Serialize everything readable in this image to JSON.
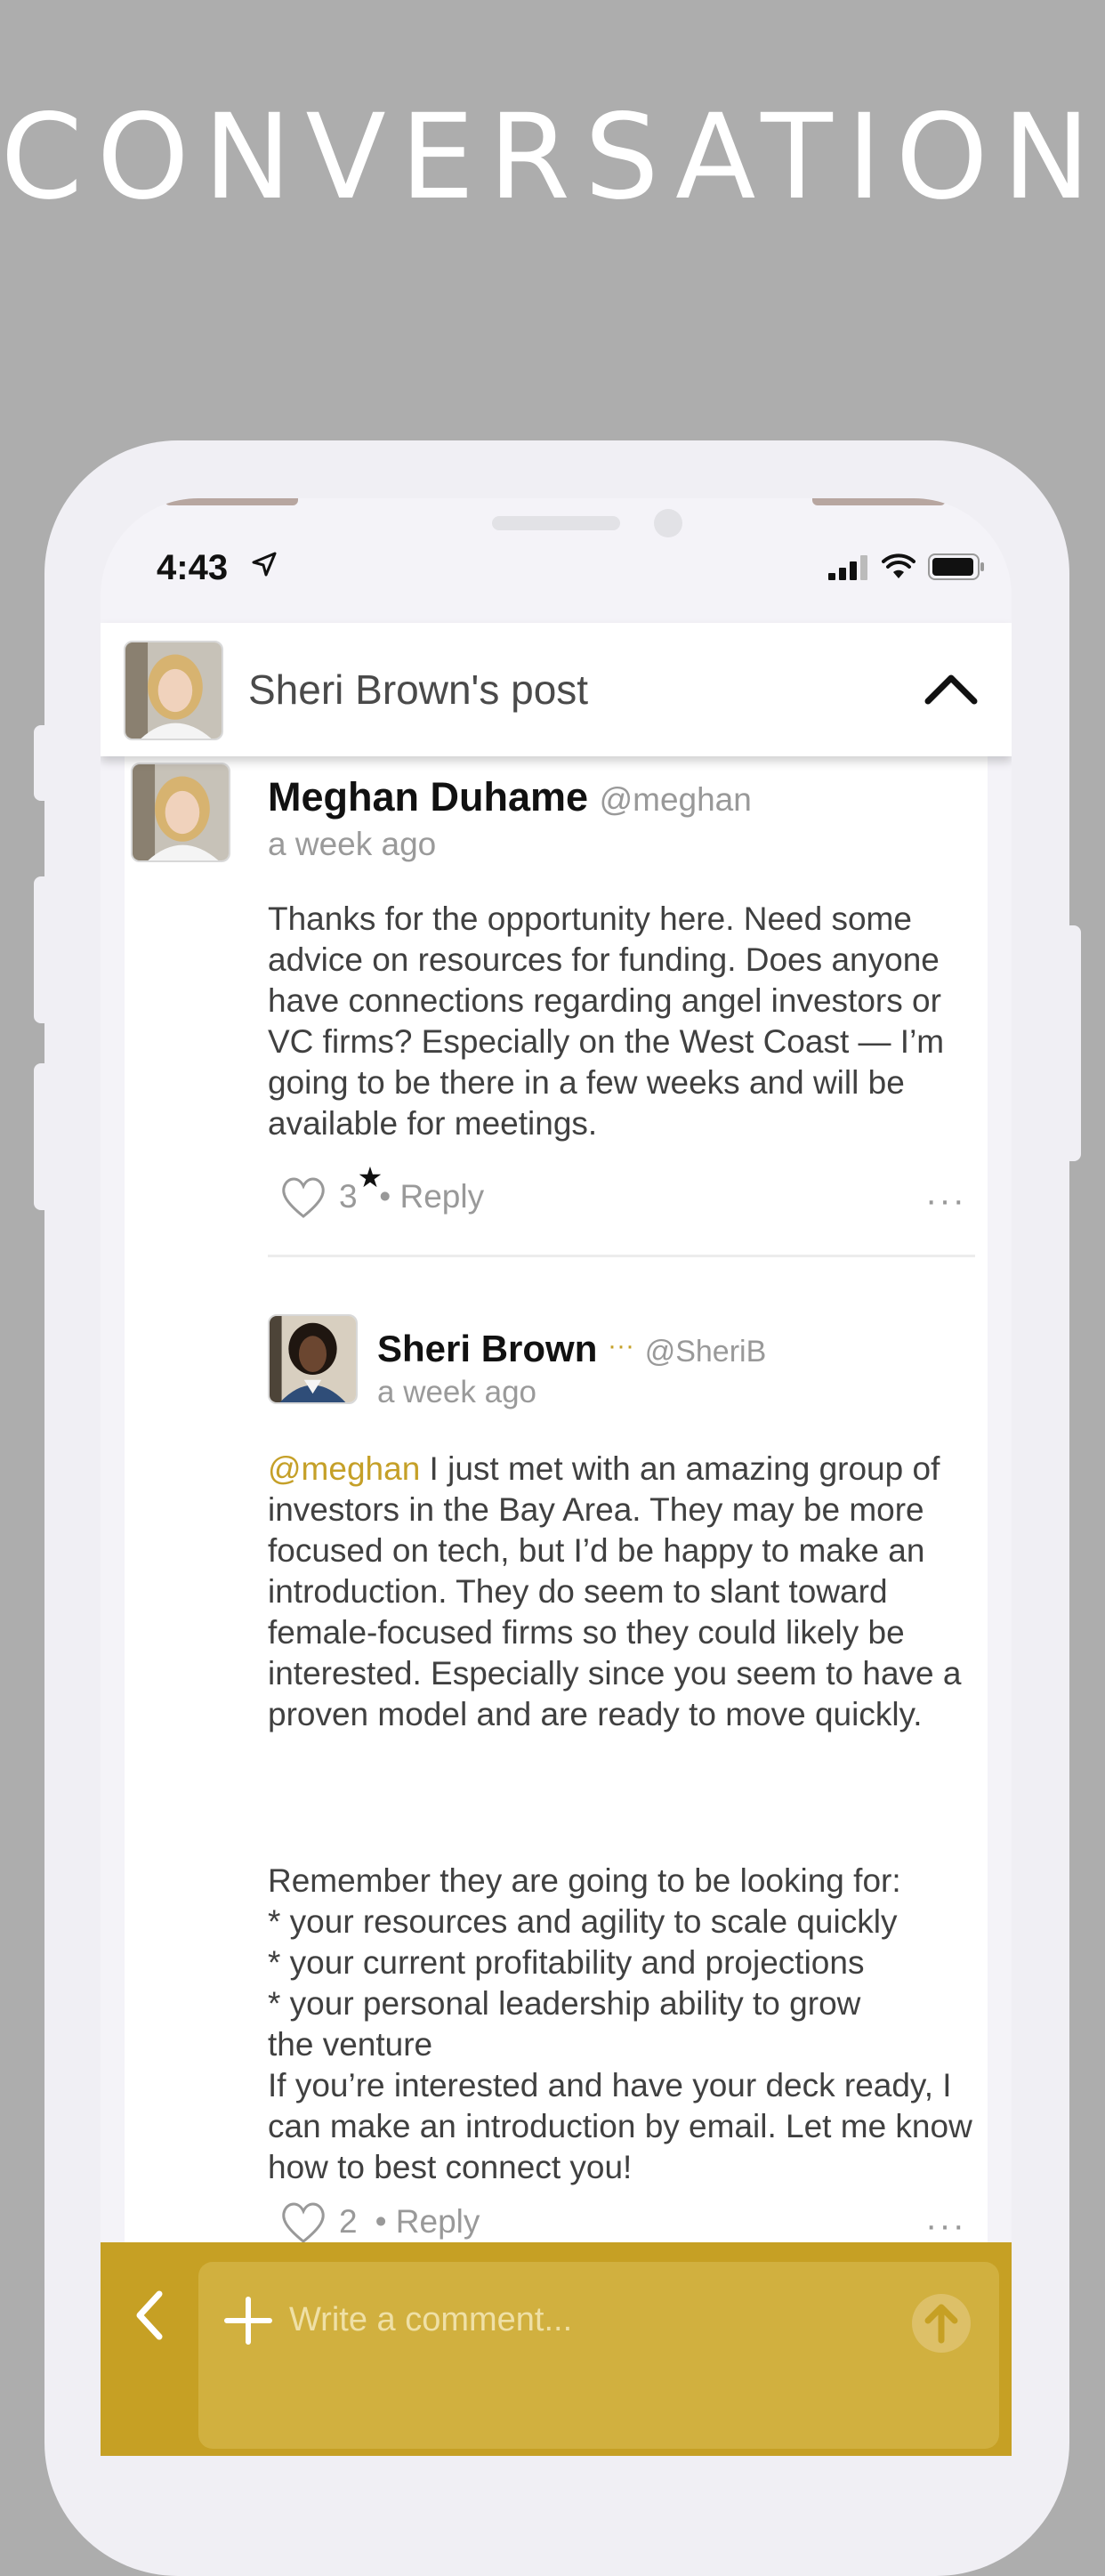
{
  "headline": "CONVERSATION",
  "status_bar": {
    "time": "4:43"
  },
  "post_header": {
    "title": "Sheri Brown's post"
  },
  "comments": [
    {
      "author": "Meghan Duhame",
      "handle": "@meghan",
      "time": "a week ago",
      "body": "Thanks for the opportunity here. Need some advice on resources for funding. Does anyone have connections regarding angel investors or VC firms? Especially on the West Coast — I’m going to be there in a few weeks and will be available for meetings.",
      "likes": "3",
      "reply_label": "• Reply",
      "more_label": "···"
    },
    {
      "author": "Sheri Brown",
      "badge": "···",
      "handle": "@SheriB",
      "time": "a week ago",
      "mention": "@meghan",
      "body_p1": " I just met with an amazing group of investors in the Bay Area. They may be more focused on tech, but I’d be happy to make an introduction. They do seem to slant toward female-focused firms so they could likely be interested. Especially since you seem to have a proven model and are ready to move quickly.",
      "body_p2_lines": [
        "Remember they are going to be looking for:",
        "* your resources and agility to scale quickly",
        "* your current profitability and projections",
        "* your personal leadership ability to grow",
        "the venture"
      ],
      "body_p3": "If you’re interested and have your deck ready, I can make an introduction by email. Let me know how to best connect you!",
      "likes": "2",
      "reply_label": "• Reply",
      "more_label": "···"
    }
  ],
  "composer": {
    "placeholder": "Write a comment..."
  },
  "colors": {
    "accent": "#c6a024",
    "mention": "#c5a028",
    "background": "#adadad"
  }
}
